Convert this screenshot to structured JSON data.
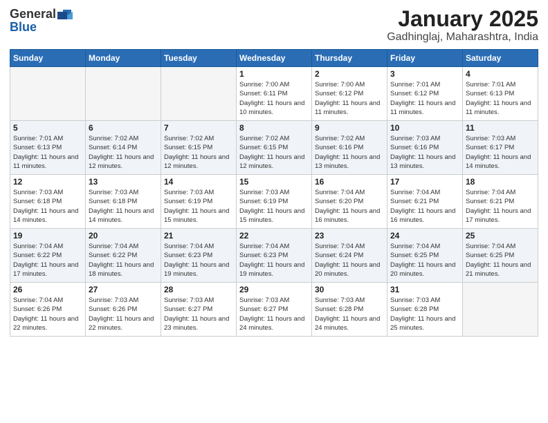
{
  "logo": {
    "general": "General",
    "blue": "Blue"
  },
  "title": "January 2025",
  "location": "Gadhinglaj, Maharashtra, India",
  "weekdays": [
    "Sunday",
    "Monday",
    "Tuesday",
    "Wednesday",
    "Thursday",
    "Friday",
    "Saturday"
  ],
  "weeks": [
    [
      {
        "day": "",
        "info": ""
      },
      {
        "day": "",
        "info": ""
      },
      {
        "day": "",
        "info": ""
      },
      {
        "day": "1",
        "info": "Sunrise: 7:00 AM\nSunset: 6:11 PM\nDaylight: 11 hours\nand 10 minutes."
      },
      {
        "day": "2",
        "info": "Sunrise: 7:00 AM\nSunset: 6:12 PM\nDaylight: 11 hours\nand 11 minutes."
      },
      {
        "day": "3",
        "info": "Sunrise: 7:01 AM\nSunset: 6:12 PM\nDaylight: 11 hours\nand 11 minutes."
      },
      {
        "day": "4",
        "info": "Sunrise: 7:01 AM\nSunset: 6:13 PM\nDaylight: 11 hours\nand 11 minutes."
      }
    ],
    [
      {
        "day": "5",
        "info": "Sunrise: 7:01 AM\nSunset: 6:13 PM\nDaylight: 11 hours\nand 11 minutes."
      },
      {
        "day": "6",
        "info": "Sunrise: 7:02 AM\nSunset: 6:14 PM\nDaylight: 11 hours\nand 12 minutes."
      },
      {
        "day": "7",
        "info": "Sunrise: 7:02 AM\nSunset: 6:15 PM\nDaylight: 11 hours\nand 12 minutes."
      },
      {
        "day": "8",
        "info": "Sunrise: 7:02 AM\nSunset: 6:15 PM\nDaylight: 11 hours\nand 12 minutes."
      },
      {
        "day": "9",
        "info": "Sunrise: 7:02 AM\nSunset: 6:16 PM\nDaylight: 11 hours\nand 13 minutes."
      },
      {
        "day": "10",
        "info": "Sunrise: 7:03 AM\nSunset: 6:16 PM\nDaylight: 11 hours\nand 13 minutes."
      },
      {
        "day": "11",
        "info": "Sunrise: 7:03 AM\nSunset: 6:17 PM\nDaylight: 11 hours\nand 14 minutes."
      }
    ],
    [
      {
        "day": "12",
        "info": "Sunrise: 7:03 AM\nSunset: 6:18 PM\nDaylight: 11 hours\nand 14 minutes."
      },
      {
        "day": "13",
        "info": "Sunrise: 7:03 AM\nSunset: 6:18 PM\nDaylight: 11 hours\nand 14 minutes."
      },
      {
        "day": "14",
        "info": "Sunrise: 7:03 AM\nSunset: 6:19 PM\nDaylight: 11 hours\nand 15 minutes."
      },
      {
        "day": "15",
        "info": "Sunrise: 7:03 AM\nSunset: 6:19 PM\nDaylight: 11 hours\nand 15 minutes."
      },
      {
        "day": "16",
        "info": "Sunrise: 7:04 AM\nSunset: 6:20 PM\nDaylight: 11 hours\nand 16 minutes."
      },
      {
        "day": "17",
        "info": "Sunrise: 7:04 AM\nSunset: 6:21 PM\nDaylight: 11 hours\nand 16 minutes."
      },
      {
        "day": "18",
        "info": "Sunrise: 7:04 AM\nSunset: 6:21 PM\nDaylight: 11 hours\nand 17 minutes."
      }
    ],
    [
      {
        "day": "19",
        "info": "Sunrise: 7:04 AM\nSunset: 6:22 PM\nDaylight: 11 hours\nand 17 minutes."
      },
      {
        "day": "20",
        "info": "Sunrise: 7:04 AM\nSunset: 6:22 PM\nDaylight: 11 hours\nand 18 minutes."
      },
      {
        "day": "21",
        "info": "Sunrise: 7:04 AM\nSunset: 6:23 PM\nDaylight: 11 hours\nand 19 minutes."
      },
      {
        "day": "22",
        "info": "Sunrise: 7:04 AM\nSunset: 6:23 PM\nDaylight: 11 hours\nand 19 minutes."
      },
      {
        "day": "23",
        "info": "Sunrise: 7:04 AM\nSunset: 6:24 PM\nDaylight: 11 hours\nand 20 minutes."
      },
      {
        "day": "24",
        "info": "Sunrise: 7:04 AM\nSunset: 6:25 PM\nDaylight: 11 hours\nand 20 minutes."
      },
      {
        "day": "25",
        "info": "Sunrise: 7:04 AM\nSunset: 6:25 PM\nDaylight: 11 hours\nand 21 minutes."
      }
    ],
    [
      {
        "day": "26",
        "info": "Sunrise: 7:04 AM\nSunset: 6:26 PM\nDaylight: 11 hours\nand 22 minutes."
      },
      {
        "day": "27",
        "info": "Sunrise: 7:03 AM\nSunset: 6:26 PM\nDaylight: 11 hours\nand 22 minutes."
      },
      {
        "day": "28",
        "info": "Sunrise: 7:03 AM\nSunset: 6:27 PM\nDaylight: 11 hours\nand 23 minutes."
      },
      {
        "day": "29",
        "info": "Sunrise: 7:03 AM\nSunset: 6:27 PM\nDaylight: 11 hours\nand 24 minutes."
      },
      {
        "day": "30",
        "info": "Sunrise: 7:03 AM\nSunset: 6:28 PM\nDaylight: 11 hours\nand 24 minutes."
      },
      {
        "day": "31",
        "info": "Sunrise: 7:03 AM\nSunset: 6:28 PM\nDaylight: 11 hours\nand 25 minutes."
      },
      {
        "day": "",
        "info": ""
      }
    ]
  ]
}
